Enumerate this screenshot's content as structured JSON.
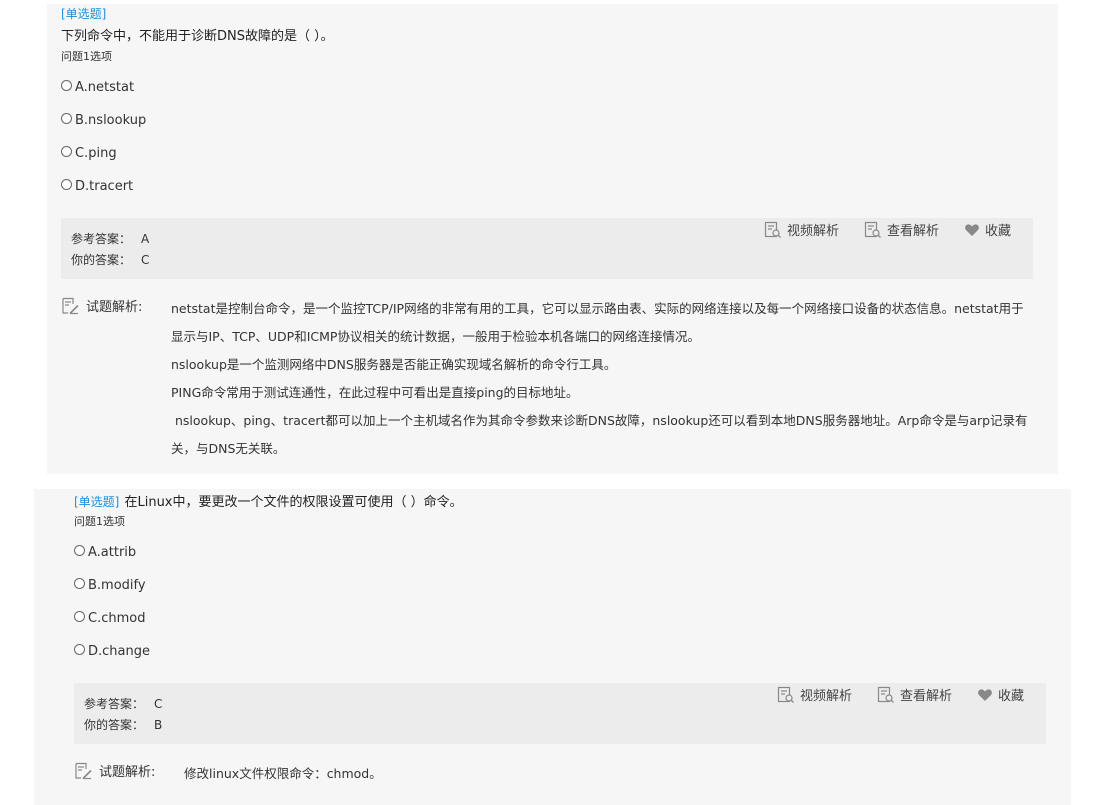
{
  "question1": {
    "tag": "[单选题]",
    "stem": "下列命令中，不能用于诊断DNS故障的是（ ）。",
    "sub": "问题1选项",
    "options": [
      "A.netstat",
      "B.nslookup",
      "C.ping",
      "D.tracert"
    ],
    "answer": {
      "ref_label": "参考答案：",
      "ref_value": "A",
      "your_label": "你的答案：",
      "your_value": "C"
    },
    "tools": {
      "video": "视频解析",
      "view": "查看解析",
      "fav": "收藏"
    },
    "analysis": {
      "label": "试题解析:",
      "lines": [
        "netstat是控制台命令，是一个监控TCP/IP网络的非常有用的工具，它可以显示路由表、实际的网络连接以及每一个网络接口设备的状态信息。netstat用于显示与IP、TCP、UDP和ICMP协议相关的统计数据，一般用于检验本机各端口的网络连接情况。",
        "nslookup是一个监测网络中DNS服务器是否能正确实现域名解析的命令行工具。",
        "PING命令常用于测试连通性，在此过程中可看出是直接ping的目标地址。",
        " nslookup、ping、tracert都可以加上一个主机域名作为其命令参数来诊断DNS故障，nslookup还可以看到本地DNS服务器地址。Arp命令是与arp记录有关，与DNS无关联。"
      ]
    }
  },
  "question2": {
    "tag": "[单选题]",
    "stem": "在Linux中，要更改一个文件的权限设置可使用（ ）命令。",
    "sub": "问题1选项",
    "options": [
      "A.attrib",
      "B.modify",
      "C.chmod",
      "D.change"
    ],
    "answer": {
      "ref_label": "参考答案：",
      "ref_value": "C",
      "your_label": "你的答案：",
      "your_value": "B"
    },
    "tools": {
      "video": "视频解析",
      "view": "查看解析",
      "fav": "收藏"
    },
    "analysis": {
      "label": "试题解析:",
      "lines": [
        "修改linux文件权限命令：chmod。"
      ]
    }
  },
  "colors": {
    "tag": "#1f8fd8",
    "panel": "#f6f6f6",
    "answer_box": "#ececec"
  }
}
